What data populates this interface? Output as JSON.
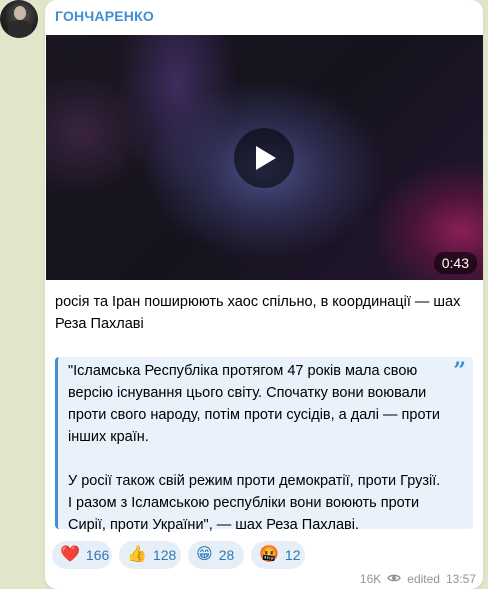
{
  "channel": {
    "sender_name": "ГОНЧАРЕНКО",
    "avatar_icon": "avatar-photo"
  },
  "video": {
    "duration": "0:43",
    "play_icon": "play-icon"
  },
  "message": {
    "caption": "росія та Іран поширюють хаос спільно, в координації — шах Реза Пахлаві",
    "quote_paragraphs": [
      "\"Ісламська Республіка протягом 47 років мала свою версію існування цього світу. Спочатку вони воювали проти свого народу, потім проти сусідів, а далі — проти інших країн.",
      "У росії також свій режим проти демократії, проти Грузії. І разом з Ісламською республіки вони воюють проти Сирії, проти України\", — шах Реза Пахлаві."
    ],
    "quote_mark": "”"
  },
  "reactions": [
    {
      "emoji": "❤️",
      "count": "166"
    },
    {
      "emoji": "👍",
      "count": "128"
    },
    {
      "emoji": "😁",
      "count": "28"
    },
    {
      "emoji": "🤬",
      "count": "12"
    }
  ],
  "meta": {
    "views": "16K",
    "edited_label": "edited",
    "time": "13:57"
  },
  "colors": {
    "accent": "#3e8fd3",
    "background": "#dfe6c9",
    "bubble": "#ffffff",
    "quote_bg": "#e9f2fb"
  }
}
